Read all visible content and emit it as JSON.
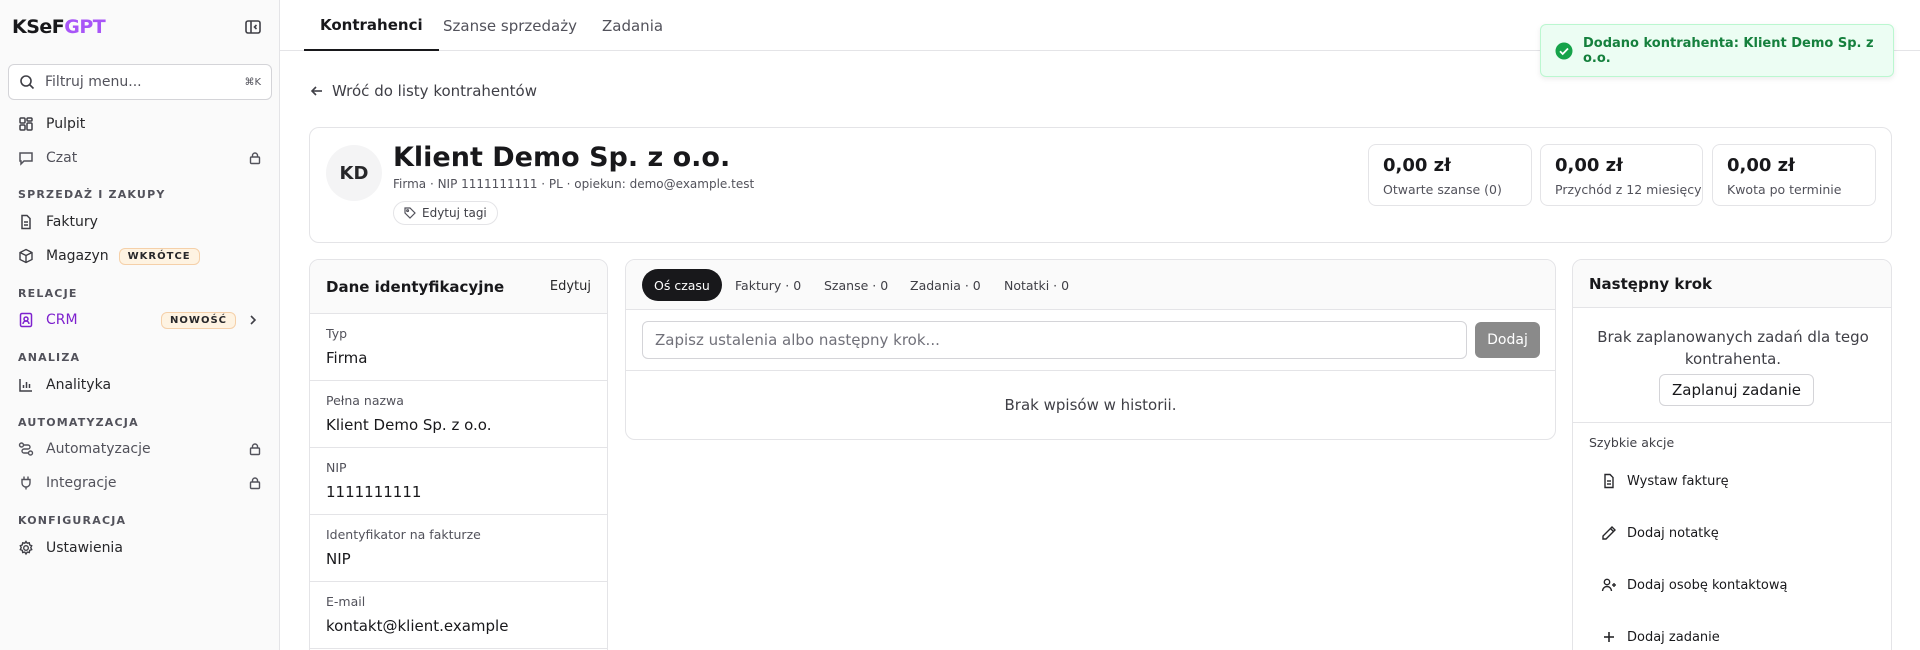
{
  "brand": {
    "part1": "KSeF",
    "part2": "GPT",
    "accent": "#a855f7"
  },
  "sidebar": {
    "filter_placeholder": "Filtruj menu...",
    "shortcut": "⌘K",
    "items": [
      {
        "label": "Pulpit",
        "icon": "home-icon"
      },
      {
        "label": "Czat",
        "icon": "chat-icon",
        "locked": true
      },
      {
        "section": "SPRZEDAŻ I ZAKUPY"
      },
      {
        "label": "Faktury",
        "icon": "document-icon"
      },
      {
        "label": "Magazyn",
        "icon": "box-icon",
        "badge": "WKRÓTCE"
      },
      {
        "section": "RELACJE"
      },
      {
        "label": "CRM",
        "icon": "contacts-icon",
        "badge": "NOWOŚĆ",
        "active": true
      },
      {
        "section": "ANALIZA"
      },
      {
        "label": "Analityka",
        "icon": "chart-icon"
      },
      {
        "section": "AUTOMATYZACJA"
      },
      {
        "label": "Automatyzacje",
        "icon": "workflow-icon",
        "locked": true
      },
      {
        "label": "Integracje",
        "icon": "plug-icon",
        "locked": true
      },
      {
        "section": "KONFIGURACJA"
      },
      {
        "label": "Ustawienia",
        "icon": "gear-icon"
      }
    ]
  },
  "tabs": [
    "Kontrahenci",
    "Szanse sprzedaży",
    "Zadania"
  ],
  "toast": {
    "text": "Dodano kontrahenta: Klient Demo Sp. z o.o.",
    "color": "#15803d"
  },
  "back_link": "Wróć do listy kontrahentów",
  "client": {
    "initials": "KD",
    "name": "Klient Demo Sp. z o.o.",
    "meta": "Firma · NIP 1111111111 · PL · opiekun: demo@example.test",
    "tags_button": "Edytuj tagi"
  },
  "stats": [
    {
      "value": "0,00 zł",
      "label": "Otwarte szanse (0)"
    },
    {
      "value": "0,00 zł",
      "label": "Przychód z 12 miesięcy"
    },
    {
      "value": "0,00 zł",
      "label": "Kwota po terminie"
    }
  ],
  "identification": {
    "title": "Dane identyfikacyjne",
    "edit": "Edytuj",
    "fields": [
      {
        "label": "Typ",
        "value": "Firma"
      },
      {
        "label": "Pełna nazwa",
        "value": "Klient Demo Sp. z o.o."
      },
      {
        "label": "NIP",
        "value": "1111111111"
      },
      {
        "label": "Identyfikator na fakturze",
        "value": "NIP"
      },
      {
        "label": "E-mail",
        "value": "kontakt@klient.example"
      }
    ]
  },
  "timeline": {
    "tabs": [
      "Oś czasu",
      "Faktury · 0",
      "Szanse · 0",
      "Zadania · 0",
      "Notatki · 0"
    ],
    "input_placeholder": "Zapisz ustalenia albo następny krok...",
    "add_button": "Dodaj",
    "empty": "Brak wpisów w historii."
  },
  "next_step": {
    "title": "Następny krok",
    "empty": "Brak zaplanowanych zadań dla tego kontrahenta.",
    "plan_button": "Zaplanuj zadanie",
    "quick_label": "Szybkie akcje",
    "actions": [
      {
        "label": "Wystaw fakturę",
        "icon": "invoice-icon"
      },
      {
        "label": "Dodaj notatkę",
        "icon": "pencil-icon"
      },
      {
        "label": "Dodaj osobę kontaktową",
        "icon": "user-plus-icon"
      },
      {
        "label": "Dodaj zadanie",
        "icon": "plus-icon"
      }
    ]
  }
}
